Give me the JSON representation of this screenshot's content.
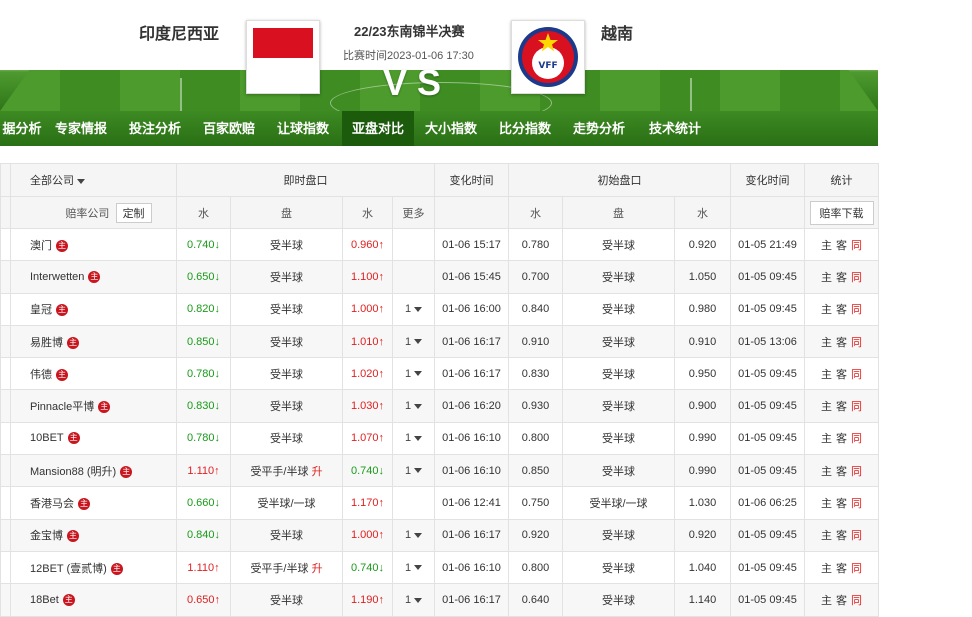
{
  "match": {
    "home_team": "印度尼西亚",
    "away_team": "越南",
    "title": "22/23东南锦半决赛",
    "time": "比赛时间2023-01-06 17:30",
    "vs": "VS",
    "away_logo_text": "VFF"
  },
  "nav": [
    "据分析",
    "专家情报",
    "投注分析",
    "百家欧赔",
    "让球指数",
    "亚盘对比",
    "大小指数",
    "比分指数",
    "走势分析",
    "技术统计"
  ],
  "nav_active": "亚盘对比",
  "table": {
    "header1": {
      "company_filter": "全部公司",
      "live": "即时盘口",
      "change_time": "变化时间",
      "initial": "初始盘口",
      "change_time2": "变化时间",
      "stats": "统计"
    },
    "header2": {
      "company": "赔率公司",
      "custom": "定制",
      "water1": "水",
      "handicap": "盘",
      "water2": "水",
      "more": "更多",
      "init_water1": "水",
      "init_handicap": "盘",
      "init_water2": "水",
      "download": "赔率下载"
    },
    "host_mark": "主",
    "stat_home": "主",
    "stat_away": "客",
    "stat_same": "同",
    "rows": [
      {
        "company": "澳门",
        "w1": "0.740↓",
        "w1c": "green",
        "hc": "受半球",
        "hcx": "",
        "w2": "0.960↑",
        "w2c": "red",
        "more": "",
        "t1": "01-06 15:17",
        "iw1": "0.780",
        "ihc": "受半球",
        "iw2": "0.920",
        "t2": "01-05 21:49"
      },
      {
        "company": "Interwetten",
        "w1": "0.650↓",
        "w1c": "green",
        "hc": "受半球",
        "hcx": "",
        "w2": "1.100↑",
        "w2c": "red",
        "more": "",
        "t1": "01-06 15:45",
        "iw1": "0.700",
        "ihc": "受半球",
        "iw2": "1.050",
        "t2": "01-05 09:45"
      },
      {
        "company": "皇冠",
        "w1": "0.820↓",
        "w1c": "green",
        "hc": "受半球",
        "hcx": "",
        "w2": "1.000↑",
        "w2c": "red",
        "more": "1",
        "t1": "01-06 16:00",
        "iw1": "0.840",
        "ihc": "受半球",
        "iw2": "0.980",
        "t2": "01-05 09:45"
      },
      {
        "company": "易胜博",
        "w1": "0.850↓",
        "w1c": "green",
        "hc": "受半球",
        "hcx": "",
        "w2": "1.010↑",
        "w2c": "red",
        "more": "1",
        "t1": "01-06 16:17",
        "iw1": "0.910",
        "ihc": "受半球",
        "iw2": "0.910",
        "t2": "01-05 13:06"
      },
      {
        "company": "伟德",
        "w1": "0.780↓",
        "w1c": "green",
        "hc": "受半球",
        "hcx": "",
        "w2": "1.020↑",
        "w2c": "red",
        "more": "1",
        "t1": "01-06 16:17",
        "iw1": "0.830",
        "ihc": "受半球",
        "iw2": "0.950",
        "t2": "01-05 09:45"
      },
      {
        "company": "Pinnacle平博",
        "w1": "0.830↓",
        "w1c": "green",
        "hc": "受半球",
        "hcx": "",
        "w2": "1.030↑",
        "w2c": "red",
        "more": "1",
        "t1": "01-06 16:20",
        "iw1": "0.930",
        "ihc": "受半球",
        "iw2": "0.900",
        "t2": "01-05 09:45"
      },
      {
        "company": "10BET",
        "w1": "0.780↓",
        "w1c": "green",
        "hc": "受半球",
        "hcx": "",
        "w2": "1.070↑",
        "w2c": "red",
        "more": "1",
        "t1": "01-06 16:10",
        "iw1": "0.800",
        "ihc": "受半球",
        "iw2": "0.990",
        "t2": "01-05 09:45"
      },
      {
        "company": "Mansion88 (明升)",
        "w1": "1.110↑",
        "w1c": "red",
        "hc": "受平手/半球",
        "hcx": "升",
        "w2": "0.740↓",
        "w2c": "green",
        "more": "1",
        "t1": "01-06 16:10",
        "iw1": "0.850",
        "ihc": "受半球",
        "iw2": "0.990",
        "t2": "01-05 09:45"
      },
      {
        "company": "香港马会",
        "w1": "0.660↓",
        "w1c": "green",
        "hc": "受半球/一球",
        "hcx": "",
        "w2": "1.170↑",
        "w2c": "red",
        "more": "",
        "t1": "01-06 12:41",
        "iw1": "0.750",
        "ihc": "受半球/一球",
        "iw2": "1.030",
        "t2": "01-06 06:25"
      },
      {
        "company": "金宝博",
        "w1": "0.840↓",
        "w1c": "green",
        "hc": "受半球",
        "hcx": "",
        "w2": "1.000↑",
        "w2c": "red",
        "more": "1",
        "t1": "01-06 16:17",
        "iw1": "0.920",
        "ihc": "受半球",
        "iw2": "0.920",
        "t2": "01-05 09:45"
      },
      {
        "company": "12BET (壹贰博)",
        "w1": "1.110↑",
        "w1c": "red",
        "hc": "受平手/半球",
        "hcx": "升",
        "w2": "0.740↓",
        "w2c": "green",
        "more": "1",
        "t1": "01-06 16:10",
        "iw1": "0.800",
        "ihc": "受半球",
        "iw2": "1.040",
        "t2": "01-05 09:45"
      },
      {
        "company": "18Bet",
        "w1": "0.650↑",
        "w1c": "red",
        "hc": "受半球",
        "hcx": "",
        "w2": "1.190↑",
        "w2c": "red",
        "more": "1",
        "t1": "01-06 16:17",
        "iw1": "0.640",
        "ihc": "受半球",
        "iw2": "1.140",
        "t2": "01-05 09:45"
      }
    ]
  }
}
